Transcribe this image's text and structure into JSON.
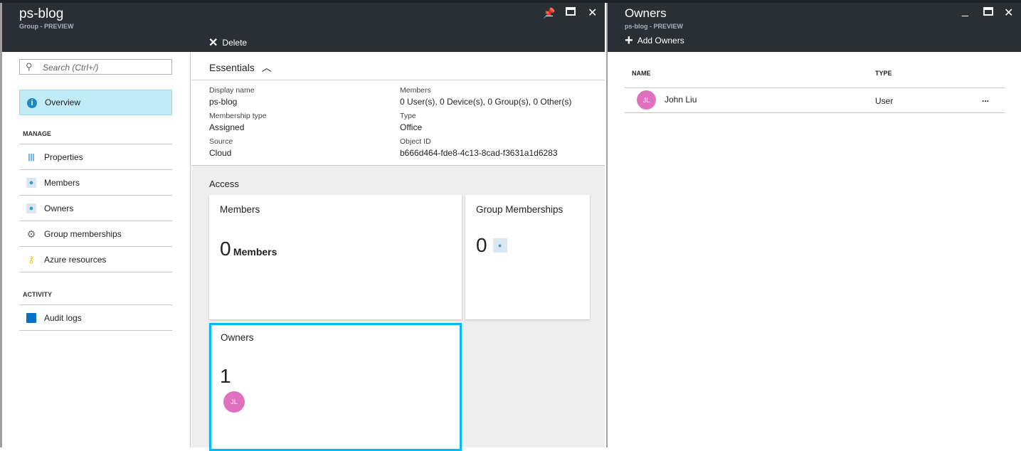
{
  "left_blade": {
    "title": "ps-blog",
    "subtitle": "Group - PREVIEW",
    "delete_label": "Delete",
    "search_placeholder": "Search (Ctrl+/)",
    "nav": {
      "overview": "Overview",
      "manage_header": "MANAGE",
      "items": [
        "Properties",
        "Members",
        "Owners",
        "Group memberships",
        "Azure resources"
      ],
      "activity_header": "ACTIVITY",
      "audit": "Audit logs"
    },
    "essentials": {
      "title": "Essentials",
      "display_name_label": "Display name",
      "display_name": "ps-blog",
      "membership_type_label": "Membership type",
      "membership_type": "Assigned",
      "source_label": "Source",
      "source": "Cloud",
      "members_label": "Members",
      "members": "0 User(s), 0 Device(s), 0 Group(s), 0 Other(s)",
      "type_label": "Type",
      "type": "Office",
      "object_id_label": "Object ID",
      "object_id": "b666d464-fde8-4c13-8cad-f3631a1d6283"
    },
    "access": {
      "title": "Access",
      "members_tile": {
        "title": "Members",
        "count": "0",
        "unit": "Members"
      },
      "group_tile": {
        "title": "Group Memberships",
        "count": "0"
      },
      "owners_tile": {
        "title": "Owners",
        "count": "1",
        "avatar": "JL"
      }
    }
  },
  "right_blade": {
    "title": "Owners",
    "subtitle": "ps-blog - PREVIEW",
    "add_label": "Add Owners",
    "columns": [
      "NAME",
      "TYPE"
    ],
    "rows": [
      {
        "initials": "JL",
        "name": "John Liu",
        "type": "User",
        "more": "..."
      }
    ]
  },
  "colors": {
    "header": "#2a2f35",
    "selected": "#c1ecf7",
    "tile_highlight": "#00bcf2",
    "avatar": "#e070c0"
  }
}
